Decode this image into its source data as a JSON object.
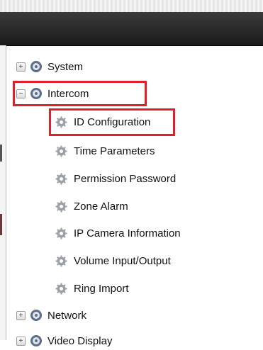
{
  "tree": {
    "items": [
      {
        "label": "System",
        "expander": "+",
        "level": 0,
        "icon": "settings-folder-icon"
      },
      {
        "label": "Intercom",
        "expander": "−",
        "level": 0,
        "icon": "settings-folder-icon",
        "highlighted": true
      },
      {
        "label": "ID Configuration",
        "level": 1,
        "icon": "gear-icon",
        "highlighted": true
      },
      {
        "label": "Time Parameters",
        "level": 1,
        "icon": "gear-icon"
      },
      {
        "label": "Permission Password",
        "level": 1,
        "icon": "gear-icon"
      },
      {
        "label": "Zone Alarm",
        "level": 1,
        "icon": "gear-icon"
      },
      {
        "label": "IP Camera Information",
        "level": 1,
        "icon": "gear-icon"
      },
      {
        "label": "Volume Input/Output",
        "level": 1,
        "icon": "gear-icon"
      },
      {
        "label": "Ring Import",
        "level": 1,
        "icon": "gear-icon"
      },
      {
        "label": "Network",
        "expander": "+",
        "level": 0,
        "icon": "settings-folder-icon"
      },
      {
        "label": "Video Display",
        "expander": "+",
        "level": 0,
        "icon": "settings-folder-icon"
      }
    ]
  },
  "colors": {
    "highlight": "#e0202a",
    "header": "#1f1f1f"
  }
}
